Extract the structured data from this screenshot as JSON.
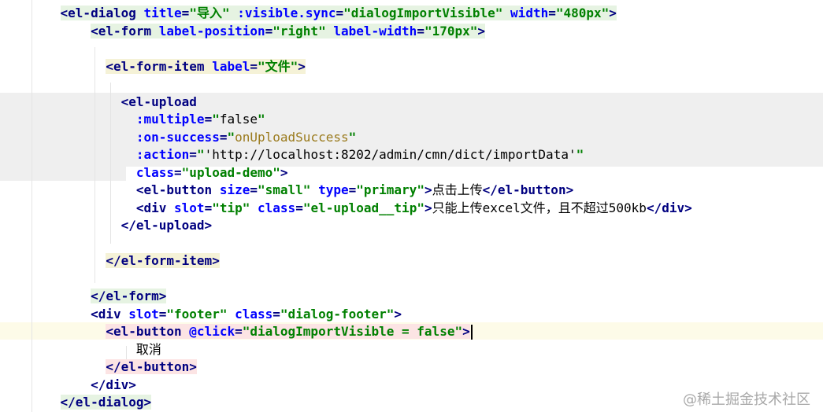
{
  "editor": {
    "lines": [
      {
        "indent": "    ",
        "hl": "g",
        "tokens": [
          {
            "t": "<el-dialog",
            "c": "tb"
          },
          {
            "t": " "
          },
          {
            "t": "title",
            "c": "an"
          },
          {
            "t": "=",
            "c": "tb"
          },
          {
            "t": "\"导入\"",
            "c": "av"
          },
          {
            "t": " "
          },
          {
            "t": ":visible.sync",
            "c": "an"
          },
          {
            "t": "=",
            "c": "tb"
          },
          {
            "t": "\"dialogImportVisible\"",
            "c": "av"
          },
          {
            "t": " "
          },
          {
            "t": "width",
            "c": "an"
          },
          {
            "t": "=",
            "c": "tb"
          },
          {
            "t": "\"480px\"",
            "c": "av"
          },
          {
            "t": ">",
            "c": "tb"
          }
        ]
      },
      {
        "indent": "        ",
        "hl": "g",
        "tokens": [
          {
            "t": "<el-form",
            "c": "tb"
          },
          {
            "t": " "
          },
          {
            "t": "label-position",
            "c": "an"
          },
          {
            "t": "=",
            "c": "tb"
          },
          {
            "t": "\"right\"",
            "c": "av"
          },
          {
            "t": " "
          },
          {
            "t": "label-width",
            "c": "an"
          },
          {
            "t": "=",
            "c": "tb"
          },
          {
            "t": "\"170px\"",
            "c": "av"
          },
          {
            "t": ">",
            "c": "tb"
          }
        ]
      },
      {
        "indent": "",
        "tokens": []
      },
      {
        "indent": "          ",
        "hl": "y",
        "tokens": [
          {
            "t": "<el-form-item",
            "c": "tb"
          },
          {
            "t": " "
          },
          {
            "t": "label",
            "c": "an"
          },
          {
            "t": "=",
            "c": "tb"
          },
          {
            "t": "\"文件\"",
            "c": "av"
          },
          {
            "t": ">",
            "c": "tb"
          }
        ]
      },
      {
        "indent": "",
        "tokens": []
      },
      {
        "indent": "            ",
        "tokens": [
          {
            "t": "<el-upload",
            "c": "tb"
          }
        ]
      },
      {
        "indent": "              ",
        "tokens": [
          {
            "t": ":multiple",
            "c": "an"
          },
          {
            "t": "=",
            "c": "tb"
          },
          {
            "t": "\"",
            "c": "av"
          },
          {
            "t": "false",
            "c": "txt"
          },
          {
            "t": "\"",
            "c": "av"
          }
        ]
      },
      {
        "indent": "              ",
        "tokens": [
          {
            "t": ":on-success",
            "c": "an"
          },
          {
            "t": "=",
            "c": "tb"
          },
          {
            "t": "\"",
            "c": "av"
          },
          {
            "t": "onUploadSuccess",
            "c": "fn"
          },
          {
            "t": "\"",
            "c": "av"
          }
        ]
      },
      {
        "indent": "              ",
        "tokens": [
          {
            "t": ":action",
            "c": "an"
          },
          {
            "t": "=",
            "c": "tb"
          },
          {
            "t": "\"",
            "c": "av"
          },
          {
            "t": "'http://localhost:8202/admin/cmn/dict/importData'",
            "c": "txt"
          },
          {
            "t": "\"",
            "c": "av"
          }
        ]
      },
      {
        "indent": "              ",
        "tokens": [
          {
            "t": "class",
            "c": "an"
          },
          {
            "t": "=",
            "c": "tb"
          },
          {
            "t": "\"upload-demo\"",
            "c": "av"
          },
          {
            "t": ">",
            "c": "tb"
          }
        ]
      },
      {
        "indent": "              ",
        "tokens": [
          {
            "t": "<el-button",
            "c": "tb"
          },
          {
            "t": " "
          },
          {
            "t": "size",
            "c": "an"
          },
          {
            "t": "=",
            "c": "tb"
          },
          {
            "t": "\"small\"",
            "c": "av"
          },
          {
            "t": " "
          },
          {
            "t": "type",
            "c": "an"
          },
          {
            "t": "=",
            "c": "tb"
          },
          {
            "t": "\"primary\"",
            "c": "av"
          },
          {
            "t": ">",
            "c": "tb"
          },
          {
            "t": "点击上传",
            "c": "txt"
          },
          {
            "t": "</el-button>",
            "c": "tb"
          }
        ]
      },
      {
        "indent": "              ",
        "tokens": [
          {
            "t": "<div",
            "c": "tb"
          },
          {
            "t": " "
          },
          {
            "t": "slot",
            "c": "an"
          },
          {
            "t": "=",
            "c": "tb"
          },
          {
            "t": "\"tip\"",
            "c": "av"
          },
          {
            "t": " "
          },
          {
            "t": "class",
            "c": "an"
          },
          {
            "t": "=",
            "c": "tb"
          },
          {
            "t": "\"el-upload__tip\"",
            "c": "av"
          },
          {
            "t": ">",
            "c": "tb"
          },
          {
            "t": "只能上传excel文件，且不超过500kb",
            "c": "txt"
          },
          {
            "t": "</div>",
            "c": "tb"
          }
        ]
      },
      {
        "indent": "            ",
        "tokens": [
          {
            "t": "</el-upload>",
            "c": "tb"
          }
        ]
      },
      {
        "indent": "",
        "tokens": []
      },
      {
        "indent": "          ",
        "hl": "y",
        "tokens": [
          {
            "t": "</el-form-item>",
            "c": "tb"
          }
        ]
      },
      {
        "indent": "",
        "tokens": []
      },
      {
        "indent": "        ",
        "hl": "g",
        "tokens": [
          {
            "t": "</el-form>",
            "c": "tb"
          }
        ]
      },
      {
        "indent": "        ",
        "tokens": [
          {
            "t": "<div",
            "c": "tb"
          },
          {
            "t": " "
          },
          {
            "t": "slot",
            "c": "an"
          },
          {
            "t": "=",
            "c": "tb"
          },
          {
            "t": "\"footer\"",
            "c": "av"
          },
          {
            "t": " "
          },
          {
            "t": "class",
            "c": "an"
          },
          {
            "t": "=",
            "c": "tb"
          },
          {
            "t": "\"dialog-footer\"",
            "c": "av"
          },
          {
            "t": ">",
            "c": "tb"
          }
        ]
      },
      {
        "indent": "          ",
        "hl": "p",
        "caret": true,
        "tokens": [
          {
            "t": "<el-button",
            "c": "tb"
          },
          {
            "t": " "
          },
          {
            "t": "@click",
            "c": "an"
          },
          {
            "t": "=",
            "c": "tb"
          },
          {
            "t": "\"dialogImportVisible = false\"",
            "c": "av"
          },
          {
            "t": ">",
            "c": "tb"
          }
        ]
      },
      {
        "indent": "              ",
        "tokens": [
          {
            "t": "取消",
            "c": "txt"
          }
        ]
      },
      {
        "indent": "          ",
        "hl": "p",
        "tokens": [
          {
            "t": "</el-button>",
            "c": "tb"
          }
        ]
      },
      {
        "indent": "        ",
        "tokens": [
          {
            "t": "</div>",
            "c": "tb"
          }
        ]
      },
      {
        "indent": "    ",
        "hl": "g",
        "tokens": [
          {
            "t": "</el-dialog>",
            "c": "tb"
          }
        ]
      }
    ]
  },
  "watermark": "@稀土掘金技术社区"
}
